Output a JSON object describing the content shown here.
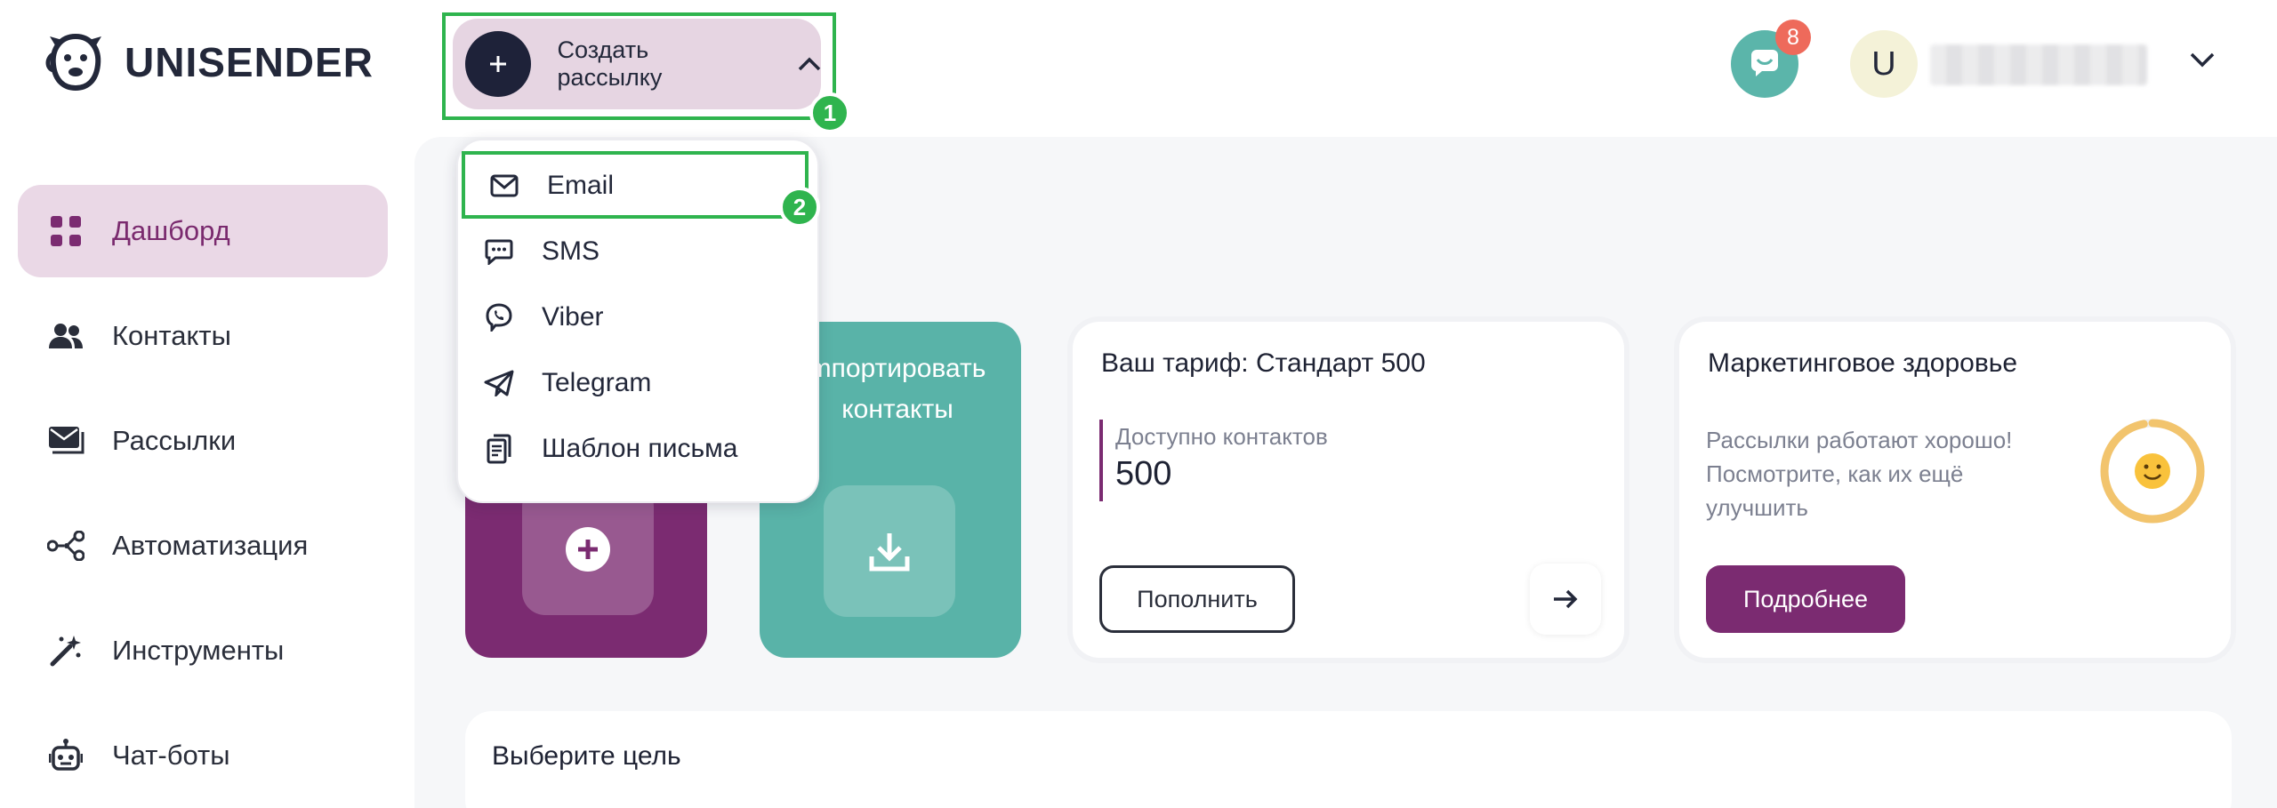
{
  "app": {
    "logo_text": "UNISENDER"
  },
  "sidebar": {
    "items": [
      {
        "label": "Дашборд",
        "icon": "grid-icon",
        "active": true
      },
      {
        "label": "Контакты",
        "icon": "people-icon"
      },
      {
        "label": "Рассылки",
        "icon": "mail-stack-icon"
      },
      {
        "label": "Автоматизация",
        "icon": "nodes-icon"
      },
      {
        "label": "Инструменты",
        "icon": "magic-wand-icon"
      },
      {
        "label": "Чат-боты",
        "icon": "robot-icon"
      }
    ]
  },
  "header": {
    "create_label": "Создать рассылку",
    "notifications_count": "8",
    "user_initial": "U"
  },
  "annotations": {
    "step1": "1",
    "step2": "2",
    "highlight_color": "#2fb44e"
  },
  "dropdown": {
    "items": [
      {
        "label": "Email",
        "icon": "envelope-icon"
      },
      {
        "label": "SMS",
        "icon": "chat-bubble-icon"
      },
      {
        "label": "Viber",
        "icon": "viber-icon"
      },
      {
        "label": "Telegram",
        "icon": "paper-plane-icon"
      },
      {
        "label": "Шаблон письма",
        "icon": "template-icon"
      }
    ]
  },
  "cards": {
    "import": {
      "title_line1": "mпортировать",
      "title_line2": "контакты"
    },
    "tariff": {
      "title": "Ваш тариф: Стандарт 500",
      "label": "Доступно контактов",
      "value": "500",
      "button": "Пополнить"
    },
    "health": {
      "title": "Маркетинговое здоровье",
      "line1": "Рассылки работают хорошо!",
      "line2": "Посмотрите, как их ещё",
      "line3": "улучшить",
      "button": "Подробнее",
      "gauge_fraction": 0.97
    },
    "goal": {
      "title": "Выберите цель"
    }
  },
  "colors": {
    "brand_purple": "#7b2b71",
    "teal": "#59b3a8",
    "navy": "#1e2239",
    "create_bg": "#e6d5e2",
    "gauge": "#f2c46d"
  }
}
